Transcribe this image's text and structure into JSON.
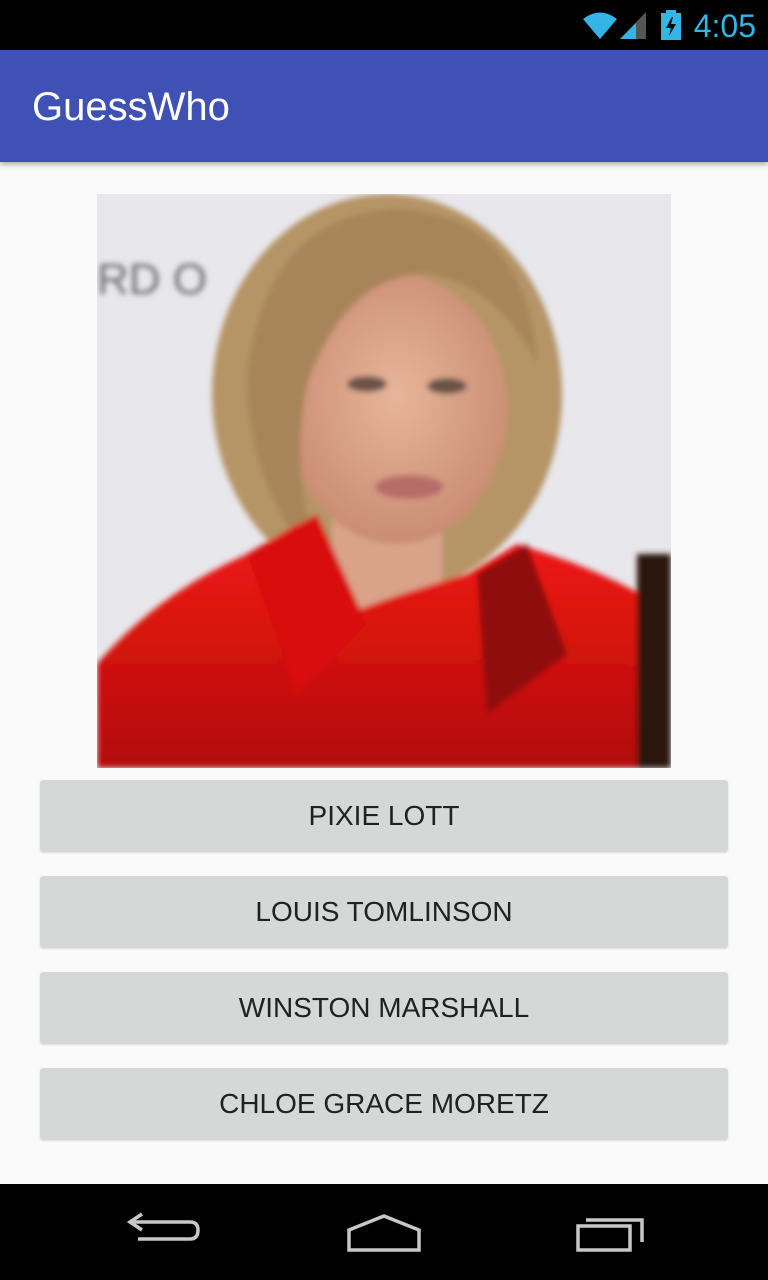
{
  "status_bar": {
    "time": "4:05",
    "icons": [
      "wifi-icon",
      "signal-icon",
      "battery-charging-icon"
    ],
    "accent_color": "#33b5e5"
  },
  "app_bar": {
    "title": "GuessWho",
    "color": "#3f51b5"
  },
  "celebrity_image": {
    "icon": "celebrity-photo",
    "background_text": "RD O"
  },
  "answers": [
    {
      "label": "PIXIE LOTT"
    },
    {
      "label": "LOUIS TOMLINSON"
    },
    {
      "label": "WINSTON MARSHALL"
    },
    {
      "label": "CHLOE GRACE MORETZ"
    }
  ],
  "nav_bar": {
    "icons": [
      "back-icon",
      "home-icon",
      "recents-icon"
    ]
  }
}
